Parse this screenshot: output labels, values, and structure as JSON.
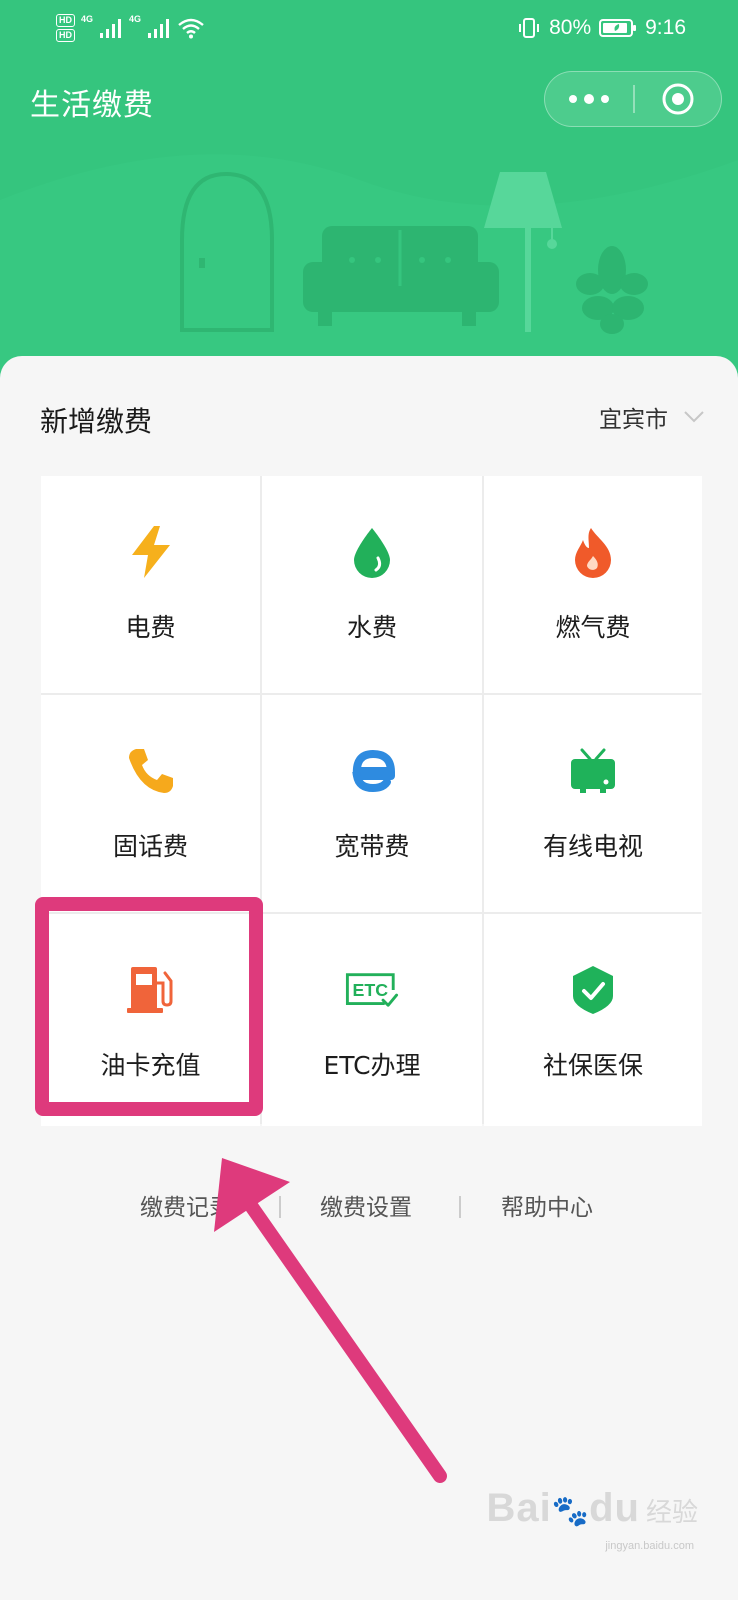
{
  "status_bar": {
    "network_1": "4G",
    "network_2": "4G",
    "hd_1": "HD",
    "hd_2": "HD",
    "battery": "80%",
    "time": "9:16"
  },
  "header": {
    "title": "生活缴费",
    "capsule_more_icon": "more-dots-icon",
    "capsule_close_icon": "target-close-icon"
  },
  "section": {
    "title": "新增缴费",
    "city": "宜宾市"
  },
  "services": [
    {
      "label": "电费",
      "icon": "lightning-icon",
      "color": "#f6b01c"
    },
    {
      "label": "水费",
      "icon": "water-drop-icon",
      "color": "#22b05a"
    },
    {
      "label": "燃气费",
      "icon": "flame-icon",
      "color": "#f05a2a"
    },
    {
      "label": "固话费",
      "icon": "phone-icon",
      "color": "#f6a91c"
    },
    {
      "label": "宽带费",
      "icon": "broadband-e-icon",
      "color": "#2e8be0"
    },
    {
      "label": "有线电视",
      "icon": "tv-icon",
      "color": "#1fb25a"
    },
    {
      "label": "油卡充值",
      "icon": "fuel-pump-icon",
      "color": "#f0643a"
    },
    {
      "label": "ETC办理",
      "icon": "etc-icon",
      "color": "#22b05a"
    },
    {
      "label": "社保医保",
      "icon": "shield-check-icon",
      "color": "#1fb25a"
    }
  ],
  "footer": {
    "links": [
      "缴费记录",
      "缴费设置",
      "帮助中心"
    ]
  },
  "watermark": {
    "brand": "Bai",
    "brand2": "du",
    "cn": "经验",
    "url": "jingyan.baidu.com"
  },
  "colors": {
    "header_green": "#35c57e",
    "highlight": "#de3a7c"
  }
}
